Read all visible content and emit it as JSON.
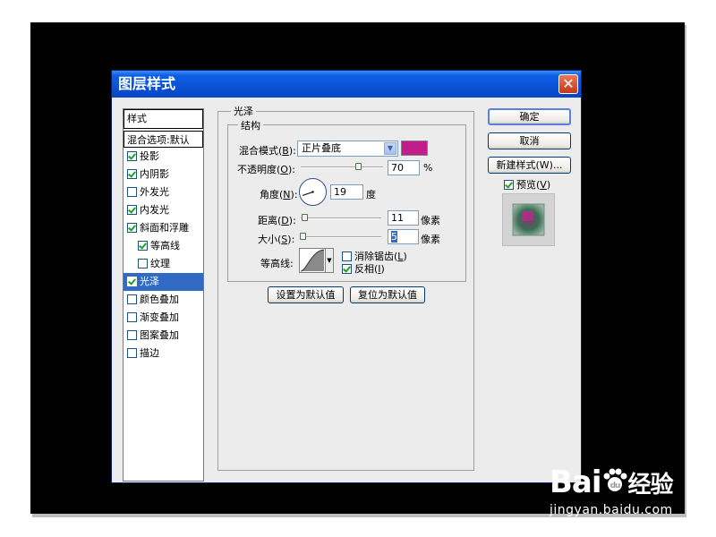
{
  "dialog": {
    "title": "图层样式",
    "close_glyph": "✕"
  },
  "styles_list": {
    "header": "样式",
    "blend_options": "混合选项:默认",
    "items": [
      {
        "label": "投影",
        "checked": true,
        "indent": 0,
        "selected": false
      },
      {
        "label": "内阴影",
        "checked": true,
        "indent": 0,
        "selected": false
      },
      {
        "label": "外发光",
        "checked": false,
        "indent": 0,
        "selected": false
      },
      {
        "label": "内发光",
        "checked": true,
        "indent": 0,
        "selected": false
      },
      {
        "label": "斜面和浮雕",
        "checked": true,
        "indent": 0,
        "selected": false
      },
      {
        "label": "等高线",
        "checked": true,
        "indent": 1,
        "selected": false
      },
      {
        "label": "纹理",
        "checked": false,
        "indent": 1,
        "selected": false
      },
      {
        "label": "光泽",
        "checked": true,
        "indent": 0,
        "selected": true
      },
      {
        "label": "颜色叠加",
        "checked": false,
        "indent": 0,
        "selected": false
      },
      {
        "label": "渐变叠加",
        "checked": false,
        "indent": 0,
        "selected": false
      },
      {
        "label": "图案叠加",
        "checked": false,
        "indent": 0,
        "selected": false
      },
      {
        "label": "描边",
        "checked": false,
        "indent": 0,
        "selected": false
      }
    ]
  },
  "satin": {
    "group_title": "光泽",
    "structure_title": "结构",
    "blend_mode": {
      "label": "混合模式(",
      "key": "B",
      "suffix": "):",
      "value": "正片叠底",
      "color": "#c21d8d"
    },
    "opacity": {
      "label": "不透明度(",
      "key": "O",
      "suffix": "):",
      "value": "70",
      "unit": "%",
      "level_percent": 70
    },
    "angle": {
      "label": "角度(",
      "key": "N",
      "suffix": "):",
      "value": "19",
      "unit": "度",
      "degrees": 19
    },
    "distance": {
      "label": "距离(",
      "key": "D",
      "suffix": "):",
      "value": "11",
      "unit": "像素",
      "level_percent": 4
    },
    "size": {
      "label": "大小(",
      "key": "S",
      "suffix": "):",
      "value": "5",
      "unit": "像素",
      "level_percent": 2
    },
    "contour": {
      "label": "等高线:",
      "antialias_label": "消除锯齿(",
      "antialias_key": "L",
      "antialias_checked": false,
      "invert_label": "反相(",
      "invert_key": "I",
      "invert_checked": true,
      "close": ")"
    },
    "set_default": "设置为默认值",
    "reset_default": "复位为默认值"
  },
  "right_panel": {
    "ok": "确定",
    "cancel": "取消",
    "new_style": "新建样式(W)...",
    "preview_label": "预览(",
    "preview_key": "V",
    "preview_close": ")",
    "preview_checked": true
  },
  "watermark": {
    "brand_a": "Bai",
    "brand_b": "经验",
    "url": "jingyan.baidu.com"
  }
}
